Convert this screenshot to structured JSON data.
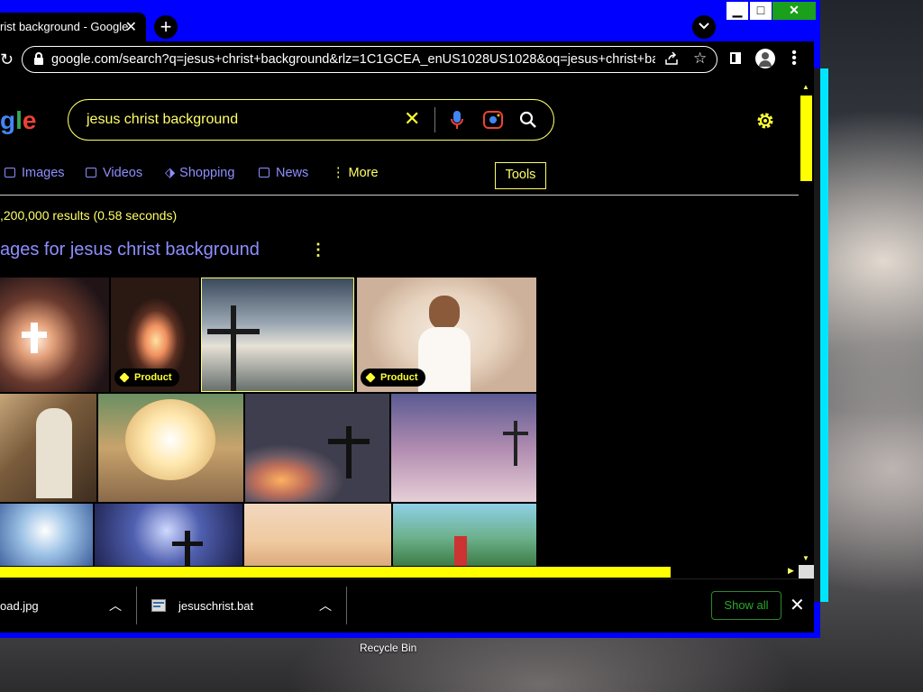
{
  "browser": {
    "tab_title": "rist background - Google",
    "tab_close": "✕",
    "new_tab": "+",
    "url": "google.com/search?q=jesus+christ+background&rlz=1C1GCEA_enUS1028US1028&oq=jesus+christ+back...",
    "window_controls": {
      "minimize": "▁",
      "maximize": "□",
      "close": "✕"
    }
  },
  "search": {
    "logo_text": [
      "g",
      "l",
      "e"
    ],
    "query": "jesus christ background",
    "clear": "✕"
  },
  "nav": {
    "tabs": [
      {
        "label": "Images",
        "icon": "image-icon"
      },
      {
        "label": "Videos",
        "icon": "video-icon"
      },
      {
        "label": "Shopping",
        "icon": "tag-icon"
      },
      {
        "label": "News",
        "icon": "news-icon"
      }
    ],
    "more": "⋮ More",
    "tools": "Tools"
  },
  "results": {
    "stats": ",200,000 results (0.58 seconds)",
    "images_heading": "ages for jesus christ background",
    "badge_label": "Product"
  },
  "downloads": {
    "items": [
      {
        "name": "oad.jpg"
      },
      {
        "name": "jesuschrist.bat"
      }
    ],
    "show_all": "Show all",
    "close": "✕"
  },
  "desktop": {
    "icon_label": "Recycle Bin"
  },
  "colors": {
    "window_frame": "#0000ff",
    "high_contrast_text": "#ffff66",
    "link": "#8e8eff"
  }
}
